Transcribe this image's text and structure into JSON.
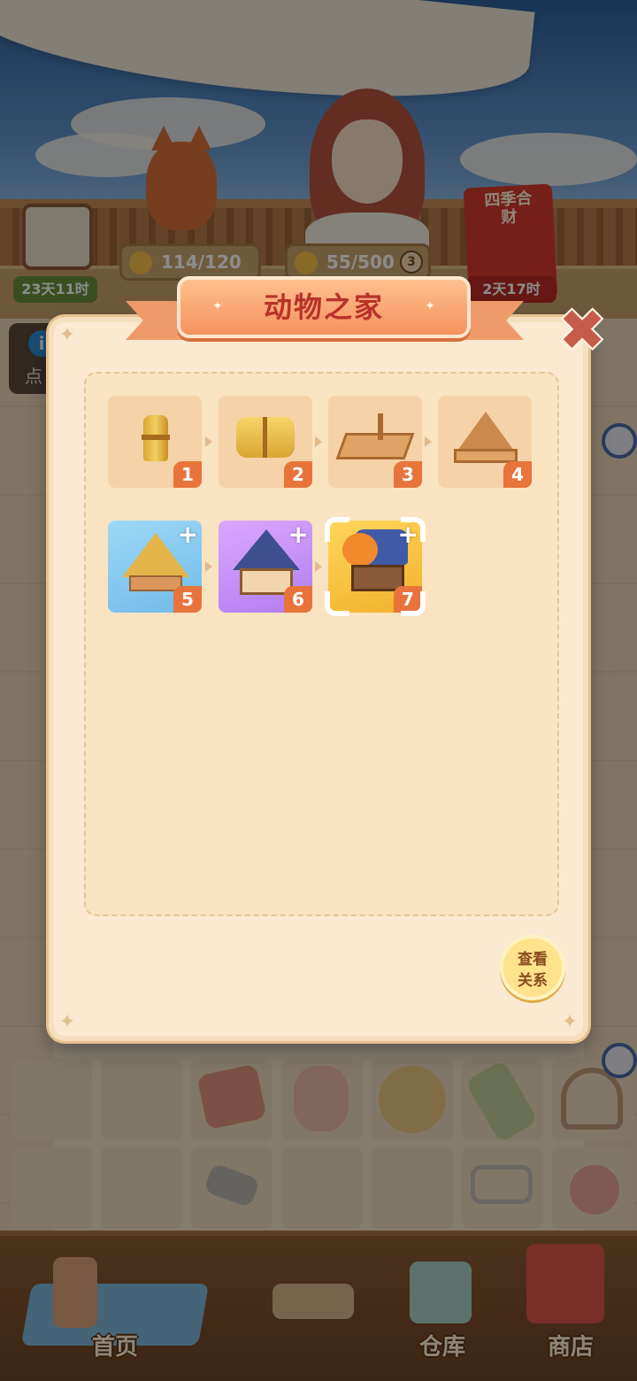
{
  "hud": {
    "avatar_timer": "23天11时",
    "energy": "114/120",
    "paw_points": "55/500",
    "paw_badge": "3",
    "event_timer": "2天17时",
    "event_label": "四季合财",
    "hint_text": "点"
  },
  "modal": {
    "title": "动物之家",
    "close_label": "✖",
    "view_button_line1": "查看",
    "view_button_line2": "关系",
    "items": [
      {
        "level": "1",
        "name": "straw-bundle"
      },
      {
        "level": "2",
        "name": "hay-bale"
      },
      {
        "level": "3",
        "name": "wood-platform"
      },
      {
        "level": "4",
        "name": "wood-frame"
      },
      {
        "level": "5",
        "name": "straw-hut",
        "plus": "+"
      },
      {
        "level": "6",
        "name": "cottage",
        "plus": "+"
      },
      {
        "level": "7",
        "name": "cat-house",
        "plus": "+"
      }
    ]
  },
  "nav": {
    "home": "首页",
    "warehouse": "仓库",
    "shop": "商店"
  },
  "colors": {
    "modal_bg": "#fbead1",
    "title_text": "#b9322a",
    "level_badge": "#e8743b",
    "close_icon": "#c65b4a"
  }
}
